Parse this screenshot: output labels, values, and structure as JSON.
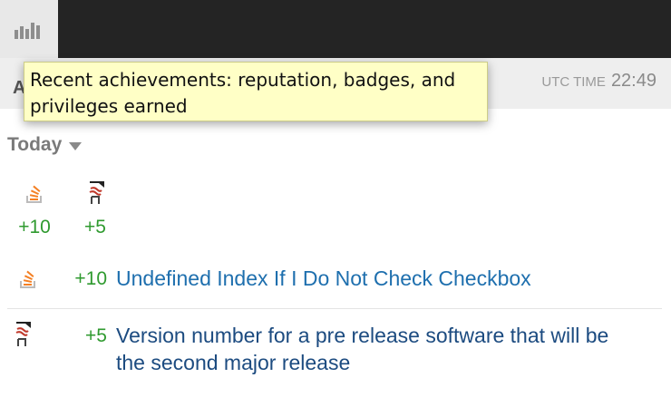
{
  "header": {
    "subheader_initial": "A",
    "utc_label": "UTC TIME",
    "utc_time": "22:49"
  },
  "tooltip": {
    "text": "Recent achievements: reputation, badges, and privileges earned"
  },
  "today": {
    "label": "Today"
  },
  "summary": [
    {
      "icon": "stackoverflow-icon",
      "amount": "+10"
    },
    {
      "icon": "software-recs-icon",
      "amount": "+5"
    }
  ],
  "events": [
    {
      "icon": "stackoverflow-icon",
      "amount": "+10",
      "title": "Undefined Index If I Do Not Check Checkbox"
    },
    {
      "icon": "software-recs-icon",
      "amount": "+5",
      "title": "Version number for a pre release software that will be the second major release"
    }
  ],
  "colors": {
    "topbar": "#242424",
    "positive": "#2f9a2f",
    "link": "#1e6fae",
    "tooltip_bg": "#ffffc6"
  }
}
